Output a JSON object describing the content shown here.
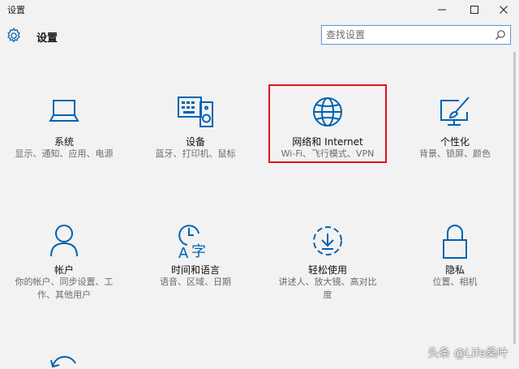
{
  "window": {
    "title": "设置",
    "buttons": {
      "minimize": "minimize-icon",
      "maximize": "maximize-icon",
      "close": "close-icon"
    }
  },
  "header": {
    "title": "设置",
    "icon": "gear-icon"
  },
  "search": {
    "placeholder": "查找设置",
    "value": "",
    "icon": "search-icon"
  },
  "accent_color": "#0063b1",
  "highlight_color": "#e0141b",
  "tiles": [
    {
      "label": "系统",
      "desc": "显示、通知、应用、电源",
      "icon": "laptop-icon"
    },
    {
      "label": "设备",
      "desc": "蓝牙、打印机、鼠标",
      "icon": "keyboard-speaker-icon"
    },
    {
      "label": "网络和 Internet",
      "desc": "Wi-Fi、飞行模式、VPN",
      "icon": "globe-icon",
      "highlighted": true
    },
    {
      "label": "个性化",
      "desc": "背景、锁屏、颜色",
      "icon": "paintbrush-monitor-icon"
    },
    {
      "label": "帐户",
      "desc": "你的帐户、同步设置、工作、其他用户",
      "icon": "person-icon"
    },
    {
      "label": "时间和语言",
      "desc": "语音、区域、日期",
      "icon": "clock-language-icon"
    },
    {
      "label": "轻松使用",
      "desc": "讲述人、放大镜、高对比度",
      "icon": "ease-of-access-icon"
    },
    {
      "label": "隐私",
      "desc": "位置、相机",
      "icon": "lock-icon"
    },
    {
      "label": "",
      "desc": "",
      "icon": "update-refresh-icon"
    }
  ],
  "watermark": "头条 @Life桑叶"
}
